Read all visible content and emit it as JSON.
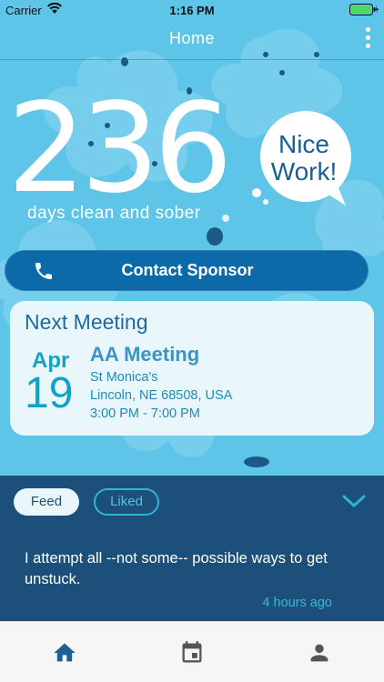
{
  "status_bar": {
    "carrier": "Carrier",
    "time": "1:16 PM",
    "icons": [
      "wifi-icon",
      "battery-icon"
    ]
  },
  "nav": {
    "title": "Home",
    "menu_icon": "more-vertical-icon"
  },
  "sobriety": {
    "count": "236",
    "caption": "days clean and sober",
    "bubble": "Nice Work!"
  },
  "contact_button": {
    "label": "Contact Sponsor",
    "icon": "phone-icon"
  },
  "next_meeting": {
    "heading": "Next Meeting",
    "month": "Apr",
    "day": "19",
    "name": "AA Meeting",
    "location": "St Monica's",
    "address": "Lincoln, NE 68508, USA",
    "time": "3:00 PM - 7:00 PM"
  },
  "feed": {
    "tabs": [
      {
        "label": "Feed",
        "active": true
      },
      {
        "label": "Liked",
        "active": false
      }
    ],
    "collapse_icon": "chevron-down-icon",
    "post": {
      "text": "I attempt all --not some-- possible ways to get unstuck.",
      "time": "4 hours ago"
    }
  },
  "tab_bar": {
    "items": [
      {
        "icon": "home-icon",
        "active": true
      },
      {
        "icon": "calendar-icon",
        "active": false
      },
      {
        "icon": "profile-icon",
        "active": false
      }
    ]
  },
  "colors": {
    "hero_background": "#5ec4e8",
    "primary_dark": "#0d6aa8",
    "feed_background": "#1c4f7a",
    "accent": "#11a3c7"
  }
}
